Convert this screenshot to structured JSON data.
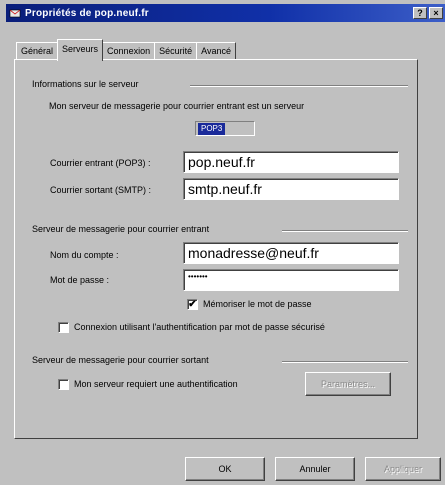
{
  "window": {
    "title": "Propriétés de pop.neuf.fr",
    "help_btn": "?",
    "close_btn": "×"
  },
  "tabs": [
    {
      "label": "Général"
    },
    {
      "label": "Serveurs"
    },
    {
      "label": "Connexion"
    },
    {
      "label": "Sécurité"
    },
    {
      "label": "Avancé"
    }
  ],
  "server_info": {
    "heading": "Informations sur le serveur",
    "incoming_type_text": "Mon serveur de messagerie pour courrier entrant est un serveur",
    "incoming_type_value": "POP3",
    "incoming_label": "Courrier entrant (POP3) :",
    "incoming_value": "pop.neuf.fr",
    "outgoing_label": "Courrier sortant (SMTP) :",
    "outgoing_value": "smtp.neuf.fr"
  },
  "incoming_server": {
    "heading": "Serveur de messagerie pour courrier entrant",
    "account_label": "Nom du compte :",
    "account_value": "monadresse@neuf.fr",
    "password_label": "Mot de passe :",
    "password_value": "•••••••",
    "remember_label": "Mémoriser le mot de passe",
    "remember_checked": "✔",
    "spa_label": "Connexion utilisant l'authentification par mot de passe sécurisé"
  },
  "outgoing_server": {
    "heading": "Serveur de messagerie pour courrier sortant",
    "auth_label": "Mon serveur requiert une authentification",
    "params_button": "Paramètres..."
  },
  "footer": {
    "ok": "OK",
    "cancel": "Annuler",
    "apply": "Appliquer"
  }
}
